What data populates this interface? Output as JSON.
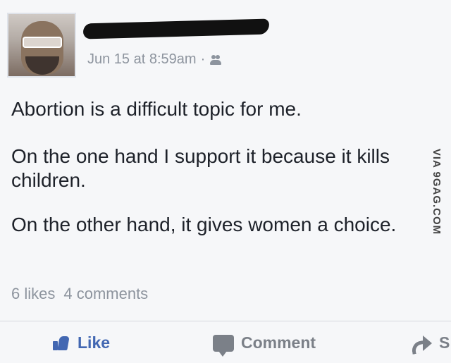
{
  "post": {
    "timestamp": "Jun 15 at 8:59am",
    "audience_icon": "friends-audience-icon",
    "paragraphs": [
      "Abortion is a difficult topic for me.",
      "On the one hand I support it because it kills children.",
      "On the other hand, it gives women a choice."
    ],
    "stats": {
      "likes": "6 likes",
      "comments": "4 comments"
    },
    "actions": {
      "like": "Like",
      "comment": "Comment",
      "share": "S"
    }
  },
  "watermark": "VIA 9GAG.COM",
  "colors": {
    "background": "#f6f7f9",
    "text": "#1d2129",
    "muted": "#8d949e",
    "like_blue": "#4267b2"
  }
}
